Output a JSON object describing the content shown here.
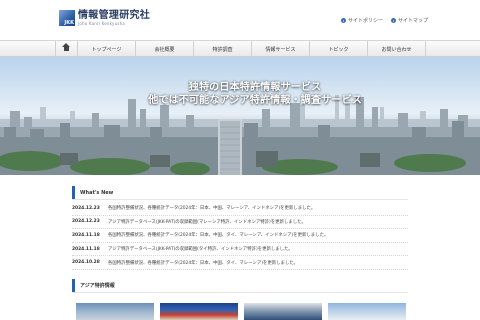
{
  "header": {
    "logo_title": "情報管理研究社",
    "logo_sub": "Joho Kanri Kenkyusha",
    "logo_mark_text": "JKK",
    "util_links": [
      "サイトポリシー",
      "サイトマップ"
    ]
  },
  "nav": {
    "home_icon": "home-icon",
    "items": [
      "トップページ",
      "会社概要",
      "特許調査",
      "情報サービス",
      "トピック",
      "お問い合わせ"
    ]
  },
  "hero": {
    "line1": "独特の日本特許情報サービス",
    "line2": "他では不可能なアジア特許情報・調査サービス"
  },
  "news": {
    "heading": "What's New",
    "items": [
      {
        "date": "2024.12.23",
        "text": "各国特許整備状況、各種統計データ(2024年：日本、中国、マレーシア、インドネシア)を更新しました。"
      },
      {
        "date": "2024.12.23",
        "text": "アジア特許データベース(JKK-PAT)の収録範囲(マレーシア特許、インドネシア特許)を更新しました。"
      },
      {
        "date": "2024.11.18",
        "text": "各国特許整備状況、各種統計データ(2024年：日本、中国、タイ、マレーシア、インドネシア)を更新しました。"
      },
      {
        "date": "2024.11.18",
        "text": "アジア特許データベース(JKK-PAT)の収録範囲(タイ特許、インドネシア特許)を更新しました。"
      },
      {
        "date": "2024.10.28",
        "text": "各国特許整備状況、各種統計データ(2024年：日本、中国、タイ、マレーシア)を更新しました。"
      }
    ]
  },
  "asia": {
    "heading": "アジア特許情報"
  },
  "colors": {
    "accent": "#2d5ea8",
    "logo_text": "#2a3f66"
  }
}
